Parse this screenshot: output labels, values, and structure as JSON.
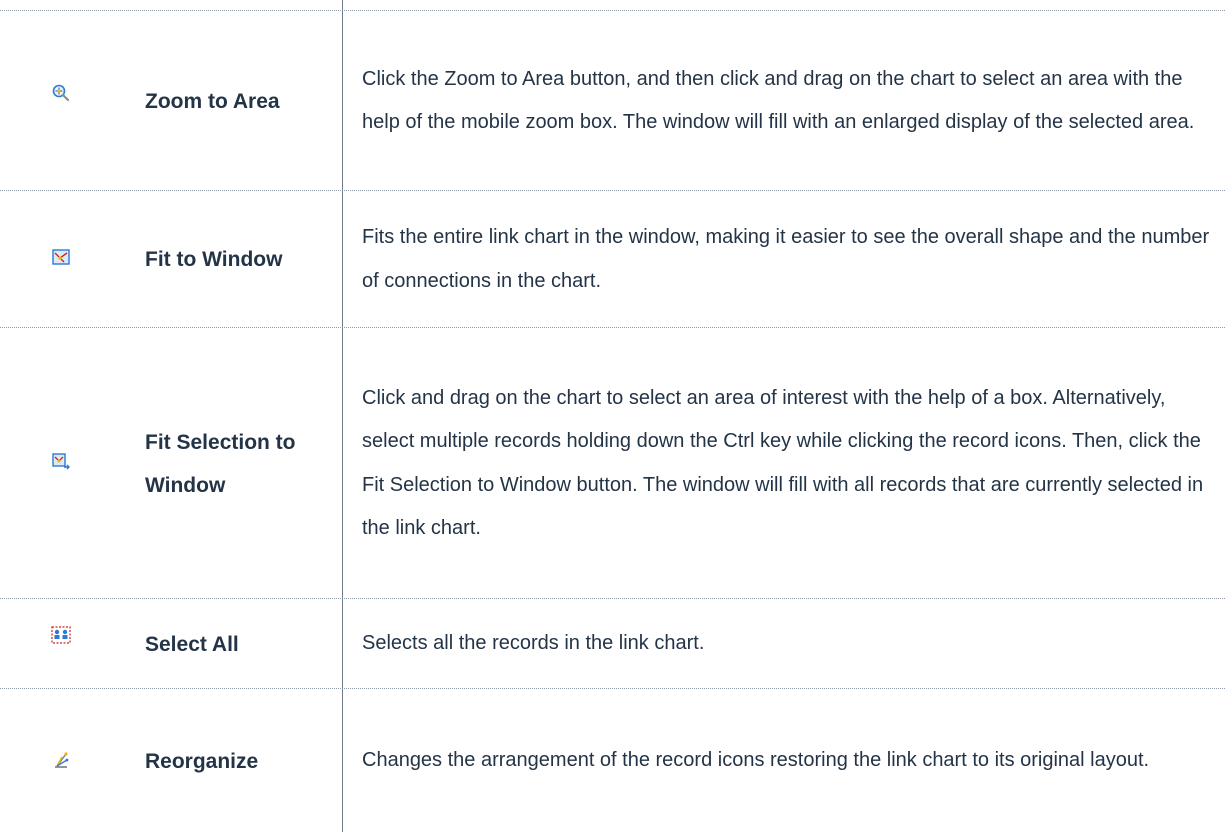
{
  "tools": [
    {
      "icon": "zoom-area-icon",
      "name": "Zoom to Area",
      "description": "Click the Zoom to Area button, and then click and drag on the chart to select an area with the help of the mobile zoom box. The window will fill with an enlarged display of the selected area."
    },
    {
      "icon": "fit-window-icon",
      "name": "Fit to Window",
      "description": "Fits the entire link chart in the window, making it easier to see the overall shape and the number of connections in the chart."
    },
    {
      "icon": "fit-selection-icon",
      "name": "Fit Selection to Window",
      "description": "Click and drag on the chart to select an area of interest with the help of a box. Alternatively, select multiple records holding down the Ctrl key while clicking the record icons. Then, click the Fit Selection to Window button. The window will fill with all records that are currently selected in the link chart."
    },
    {
      "icon": "select-all-icon",
      "name": "Select All",
      "description": "Selects all the records in the link chart."
    },
    {
      "icon": "reorganize-icon",
      "name": "Reorganize",
      "description": "Changes the arrangement of the record icons restoring the link chart to its original layout."
    }
  ],
  "colors": {
    "text": "#243447",
    "divider": "#8e9aa6",
    "accent_blue": "#2d7ad6",
    "accent_red": "#d61f1f",
    "accent_yellow": "#e7b900"
  }
}
